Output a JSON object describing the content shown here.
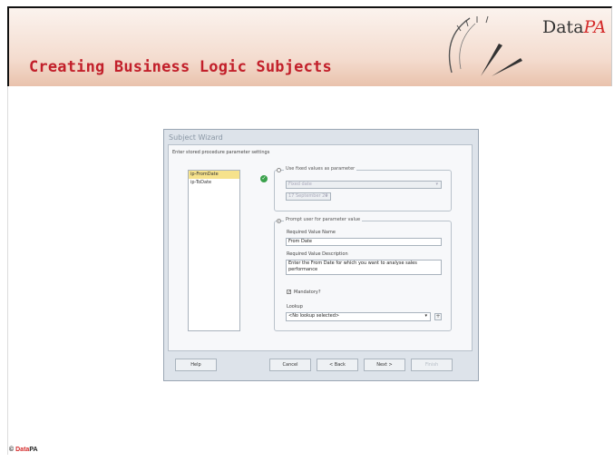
{
  "slide": {
    "title": "Creating Business Logic Subjects",
    "logo": {
      "data": "Data",
      "pa": "PA"
    },
    "footer": {
      "copyright": "©",
      "brand_data": "Data",
      "brand_pa": "PA"
    }
  },
  "wizard": {
    "title": "Subject Wizard",
    "instruction": "Enter stored procedure parameter settings",
    "parameters": [
      {
        "label": "ip-FromDate",
        "selected": true
      },
      {
        "label": "ip-ToDate",
        "selected": false
      }
    ],
    "fixed": {
      "label": "Use fixed values as parameter",
      "selected": false,
      "type_value": "Fixed date",
      "date_value": "17 September 20"
    },
    "prompt": {
      "label": "Prompt user for parameter value",
      "selected": true,
      "name_label": "Required Value Name",
      "name_value": "From Date",
      "desc_label": "Required Value Description",
      "desc_value": "Enter the From Date for which you want to analyse sales performance",
      "mandatory_label": "Mandatory?",
      "mandatory_checked": true,
      "lookup_label": "Lookup",
      "lookup_value": "<No lookup selected>"
    },
    "buttons": {
      "help": "Help",
      "cancel": "Cancel",
      "back": "< Back",
      "next": "Next >",
      "finish": "Finish"
    },
    "colors": {
      "selected_item": "#f6e28c",
      "ok": "#3aa14b",
      "title_accent": "#c21f2a"
    }
  }
}
